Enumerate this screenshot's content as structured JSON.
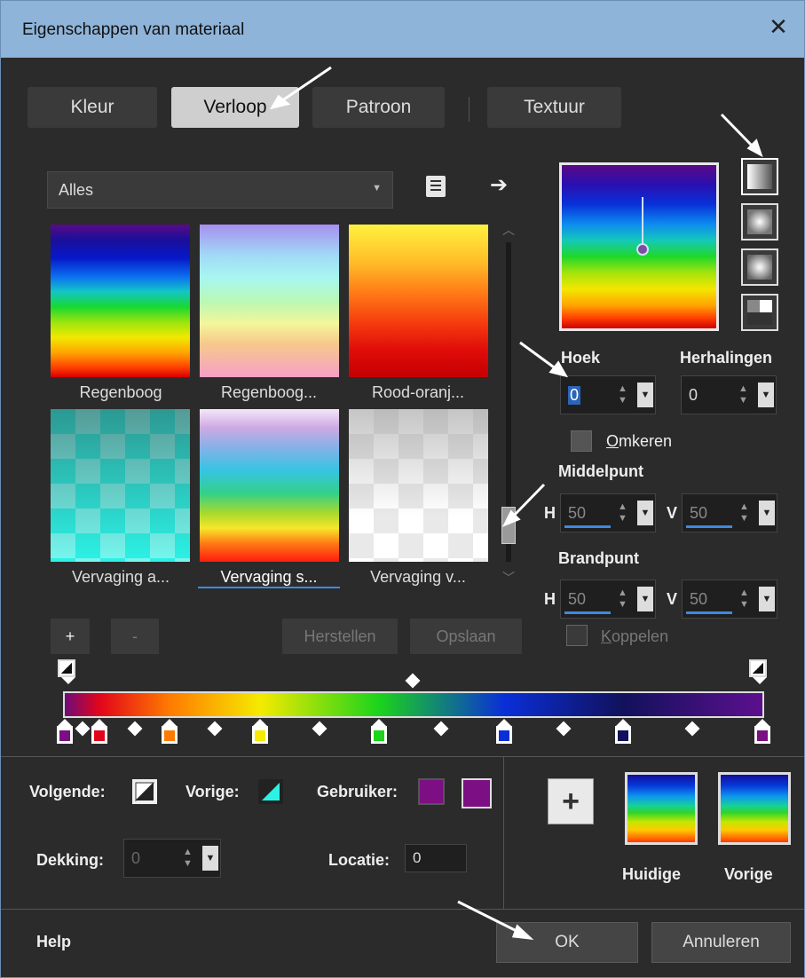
{
  "window": {
    "title": "Eigenschappen van materiaal",
    "close_glyph": "✕"
  },
  "tabs": [
    {
      "label": "Kleur",
      "active": false
    },
    {
      "label": "Verloop",
      "active": true
    },
    {
      "label": "Patroon",
      "active": false
    },
    {
      "label": "Textuur",
      "active": false
    }
  ],
  "filter": {
    "value": "Alles",
    "caret": "▼"
  },
  "icons": {
    "list": "list-options-icon",
    "export": "➔"
  },
  "gradients": [
    {
      "label": "Regenboog"
    },
    {
      "label": "Regenboog..."
    },
    {
      "label": "Rood-oranj..."
    },
    {
      "label": "Vervaging a..."
    },
    {
      "label": "Vervaging s...",
      "selected": true
    },
    {
      "label": "Vervaging v..."
    }
  ],
  "scroll": {
    "up": "︿",
    "down": "﹀"
  },
  "angle": {
    "label": "Hoek",
    "value": "0"
  },
  "repeats": {
    "label": "Herhalingen",
    "value": "0"
  },
  "invert": {
    "label_first": "O",
    "label_rest": "mkeren"
  },
  "center": {
    "label": "Middelpunt",
    "h_label": "H",
    "h_value": "50",
    "v_label": "V",
    "v_value": "50"
  },
  "focal": {
    "label": "Brandpunt",
    "h_label": "H",
    "h_value": "50",
    "v_label": "V",
    "v_value": "50"
  },
  "link": {
    "label_first": "K",
    "label_rest": "oppelen"
  },
  "editor_buttons": {
    "add": "+",
    "remove": "-",
    "reset": "Herstellen",
    "save": "Opslaan"
  },
  "gradient_stops": [
    {
      "color": "#7b0f83",
      "location": 0
    },
    {
      "color": "#e2051a",
      "location": 5
    },
    {
      "color": "#ff7a00",
      "location": 15
    },
    {
      "color": "#f5ea00",
      "location": 28
    },
    {
      "color": "#1bd41b",
      "location": 45
    },
    {
      "color": "#0a2fd8",
      "location": 63
    },
    {
      "color": "#11115c",
      "location": 80
    },
    {
      "color": "#7b0f83",
      "location": 100
    }
  ],
  "bottom": {
    "next_label": "Volgende:",
    "prev_label": "Vorige:",
    "user_label": "Gebruiker:",
    "user_colors": [
      "#7b0f83",
      "#7b0f83"
    ],
    "opacity_label": "Dekking:",
    "opacity_value": "0",
    "location_label": "Locatie:",
    "location_value": "0",
    "add_button": "+",
    "current_label": "Huidige",
    "previous_label": "Vorige"
  },
  "footer": {
    "help": "Help",
    "ok": "OK",
    "cancel": "Annuleren"
  },
  "spinner": {
    "arrows": "▲\n▼",
    "drop": "▼"
  }
}
